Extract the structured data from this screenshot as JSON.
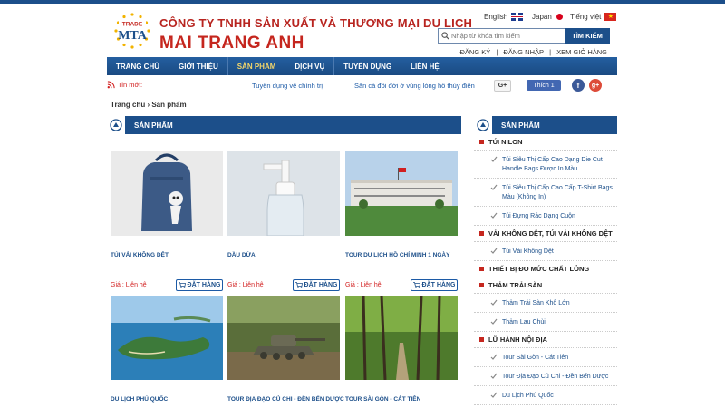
{
  "header": {
    "company_line1": "CÔNG TY TNHH SẢN XUẤT VÀ THƯƠNG MẠI DU LỊCH",
    "company_line2": "MAI TRANG ANH",
    "logo_text_top": "TRADE",
    "logo_text_main": "MTA"
  },
  "languages": [
    {
      "label": "English",
      "icon": "uk-flag-icon"
    },
    {
      "label": "Japan",
      "icon": "japan-flag-icon"
    },
    {
      "label": "Tiếng việt",
      "icon": "vietnam-flag-icon"
    }
  ],
  "search": {
    "placeholder": "Nhập từ khóa tìm kiếm",
    "button_label": "TÌM KIẾM"
  },
  "account": {
    "register": "ĐĂNG KÝ",
    "login": "ĐĂNG NHẬP",
    "cart": "XEM GIỎ HÀNG",
    "separator": "|"
  },
  "nav": {
    "items": [
      "TRANG CHỦ",
      "GIỚI THIỆU",
      "SẢN PHẨM",
      "DỊCH VỤ",
      "TUYỂN DỤNG",
      "LIÊN HỆ"
    ],
    "active_index": 2
  },
  "news": {
    "label": "Tin mới:",
    "items": [
      "Tuyển dụng về chính trị",
      "Săn cá đối đời ở vùng lòng hồ thủy điện"
    ],
    "gplus": "G+",
    "fb_like": "Thích 1",
    "fb_circle": "f",
    "gplus_circle": "g+"
  },
  "breadcrumb": "Trang chủ › Sản phẩm",
  "main_section": {
    "title": "SẢN PHẨM"
  },
  "products": [
    {
      "name": "TÚI VẢI KHÔNG DỆT",
      "price": "Giá : Liên hệ",
      "order": "ĐẶT HÀNG"
    },
    {
      "name": "DẦU DỪA",
      "price": "Giá : Liên hệ",
      "order": "ĐẶT HÀNG"
    },
    {
      "name": "TOUR DU LỊCH HỒ CHÍ MINH 1 NGÀY",
      "price": "Giá : Liên hệ",
      "order": "ĐẶT HÀNG"
    },
    {
      "name": "DU LỊCH PHÚ QUỐC"
    },
    {
      "name": "TOUR ĐỊA ĐẠO CỦ CHI - ĐỀN BẾN DƯỢC"
    },
    {
      "name": "TOUR SÀI GÒN - CÁT TIÊN"
    }
  ],
  "sidebar": {
    "title": "SẢN PHẨM",
    "entries": [
      {
        "type": "cat",
        "label": "TÚI NILON"
      },
      {
        "type": "sub",
        "label": "Túi Siêu Thị Cấp Cao Dạng Die Cut Handle Bags Được In Màu"
      },
      {
        "type": "sub",
        "label": "Túi Siêu Thị Cấp Cao Cấp T-Shirt Bags Màu (Không In)"
      },
      {
        "type": "sub",
        "label": "Túi Đựng Rác Dạng Cuộn"
      },
      {
        "type": "cat",
        "label": "VẢI KHÔNG DỆT, TÚI VẢI KHÔNG DỆT"
      },
      {
        "type": "sub",
        "label": "Túi Vải Không Dệt"
      },
      {
        "type": "cat",
        "label": "THIẾT BỊ ĐO MỨC CHẤT LỎNG"
      },
      {
        "type": "cat",
        "label": "THẢM TRẢI SÀN"
      },
      {
        "type": "sub",
        "label": "Thảm Trải Sàn Khổ Lớn"
      },
      {
        "type": "sub",
        "label": "Thảm Lau Chùi"
      },
      {
        "type": "cat",
        "label": "LỮ HÀNH NỘI ĐỊA"
      },
      {
        "type": "sub",
        "label": "Tour Sài Gòn - Cát Tiên"
      },
      {
        "type": "sub",
        "label": "Tour Địa Đạo Củ Chi - Đền Bến Dược"
      },
      {
        "type": "sub",
        "label": "Du Lịch Phú Quốc"
      }
    ]
  },
  "colors": {
    "brand_blue": "#1c4f8a",
    "brand_red": "#c5261e",
    "active_nav": "#f5d76a",
    "link_blue": "#1c5aa6"
  }
}
